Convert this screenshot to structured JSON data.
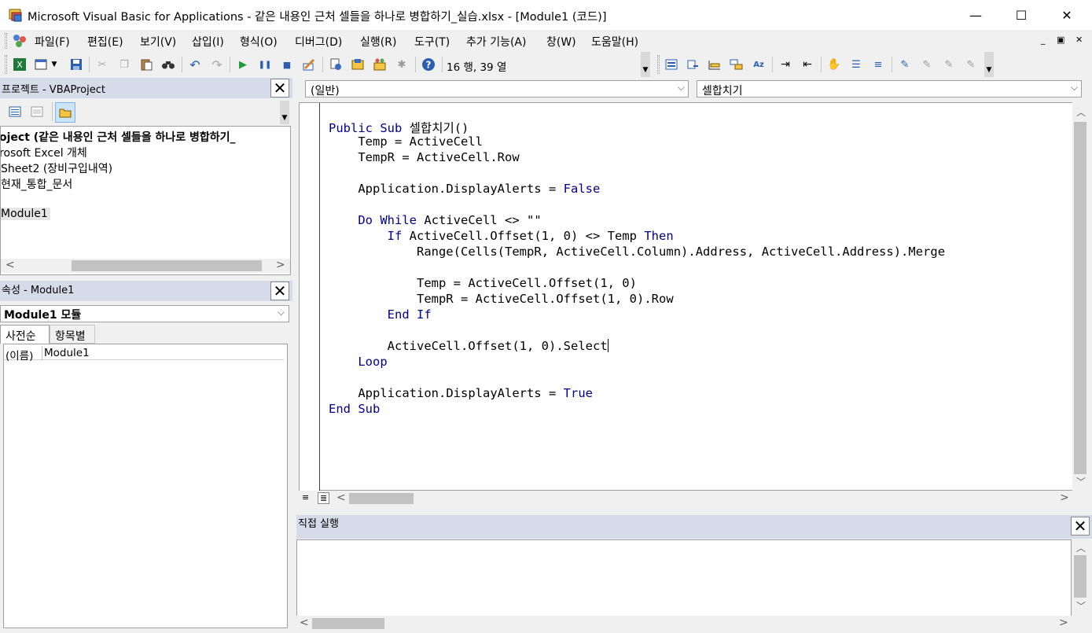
{
  "window": {
    "title": "Microsoft Visual Basic for Applications - 같은 내용인 근처 셀들을 하나로 병합하기_실습.xlsx - [Module1 (코드)]",
    "minimize": "—",
    "maximize": "☐",
    "close": "✕"
  },
  "menu": {
    "items": [
      "파일(F)",
      "편집(E)",
      "보기(V)",
      "삽입(I)",
      "형식(O)",
      "디버그(D)",
      "실행(R)",
      "도구(T)",
      "추가 기능(A)",
      "창(W)",
      "도움말(H)"
    ],
    "mdi_min": "_",
    "mdi_restore": "▣",
    "mdi_close": "✕"
  },
  "toolbar": {
    "status": "16 행, 39 열"
  },
  "project": {
    "title": "프로젝트 - VBAProject",
    "tree": [
      "oject (같은 내용인 근처 셀들을 하나로 병합하기_",
      "rosoft Excel 개체",
      "Sheet2 (장비구입내역)",
      "현재_통합_문서",
      "",
      "Module1"
    ]
  },
  "properties": {
    "title": "속성 - Module1",
    "object_select": "Module1 모듈",
    "tab_alpha": "사전순",
    "tab_category": "항목별",
    "row_name": "(이름)",
    "row_value": "Module1"
  },
  "code": {
    "object_combo": "(일반)",
    "proc_combo": "셀합치기",
    "lines": [
      "Public Sub 셀합치기()",
      "    Temp = ActiveCell",
      "    TempR = ActiveCell.Row",
      "",
      "    Application.DisplayAlerts = False",
      "",
      "    Do While ActiveCell <> \"\"",
      "        If ActiveCell.Offset(1, 0) <> Temp Then",
      "            Range(Cells(TempR, ActiveCell.Column).Address, ActiveCell.Address).Merge",
      "",
      "            Temp = ActiveCell.Offset(1, 0)",
      "            TempR = ActiveCell.Offset(1, 0).Row",
      "        End If",
      "",
      "        ActiveCell.Offset(1, 0).Select",
      "    Loop",
      "",
      "    Application.DisplayAlerts = True",
      "End Sub"
    ]
  },
  "immediate": {
    "title": "직접 실행"
  },
  "colors": {
    "keyword": "#00008b",
    "pane_header": "#d6dbe9"
  }
}
